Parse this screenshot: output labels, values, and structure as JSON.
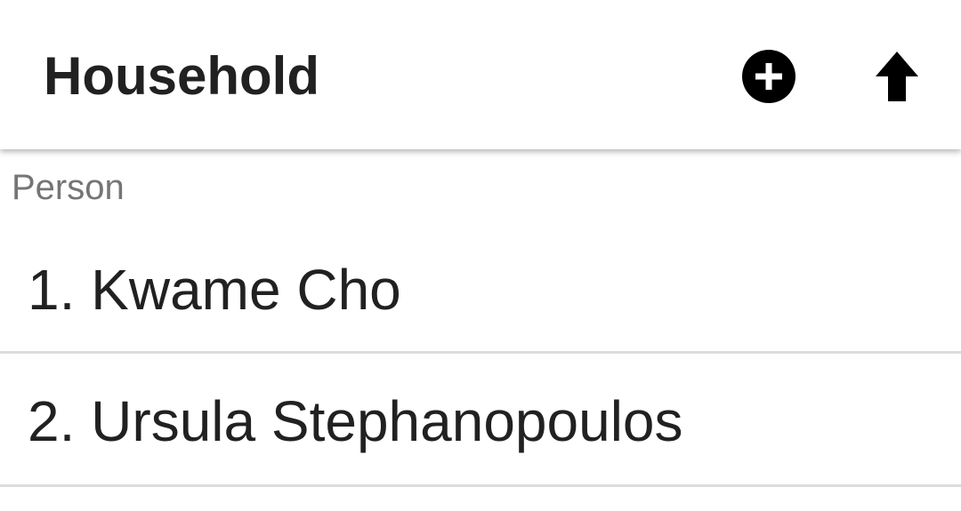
{
  "toolbar": {
    "title": "Household",
    "actions": [
      {
        "icon": "add-circle-icon"
      },
      {
        "icon": "arrow-upward-icon"
      }
    ]
  },
  "section": {
    "header": "Person"
  },
  "people": [
    {
      "label": "1. Kwame Cho"
    },
    {
      "label": "2. Ursula Stephanopoulos"
    }
  ],
  "colors": {
    "text_primary": "#212121",
    "text_secondary": "#757575",
    "divider": "#dcdcdc",
    "background": "#ffffff"
  }
}
